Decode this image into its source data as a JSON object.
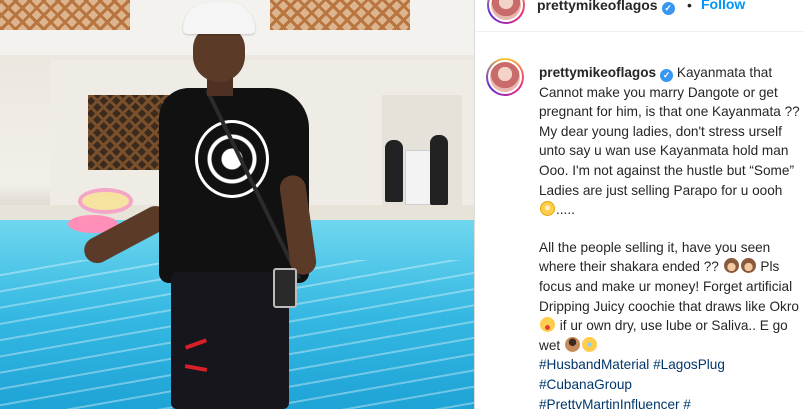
{
  "post": {
    "username": "prettymikeoflagos",
    "verified_glyph": "✓",
    "header_separator": "•",
    "follow_label": "Follow"
  },
  "caption": {
    "para1": "Kayanmata that Cannot make you marry Dangote or get pregnant for him, is that one Kayanmata ?? My dear young ladies, don't stress urself unto say u wan use Kayanmata hold man Ooo. I'm not against the hustle but “Some” Ladies are just selling Parapo for u oooh",
    "para1_tail": ".....",
    "para2_a": "All the people selling it, have you seen where their shakara ended ??",
    "para2_b": "Pls focus and make ur money! Forget artificial Dripping Juicy coochie that draws like Okro",
    "para2_c": "if ur own dry, use lube or Saliva.. E go wet",
    "hashtags_line1": "#HusbandMaterial #LagosPlug",
    "hashtags_line2": "#CubanaGroup",
    "hashtags_line3": "#PrettyMartinInfluencer #"
  },
  "icons": {
    "emoji_1": "flushed-face",
    "emoji_2": "see-no-evil-monkey",
    "emoji_3": "see-no-evil-monkey",
    "emoji_4": "winking-tongue-face",
    "emoji_5": "person-facepalming",
    "emoji_6": "rolling-on-floor-laughing",
    "verified": "verified-badge"
  },
  "colors": {
    "link_blue": "#0095f6",
    "hashtag": "#00376b",
    "verified": "#3897f0",
    "text": "#262626"
  }
}
